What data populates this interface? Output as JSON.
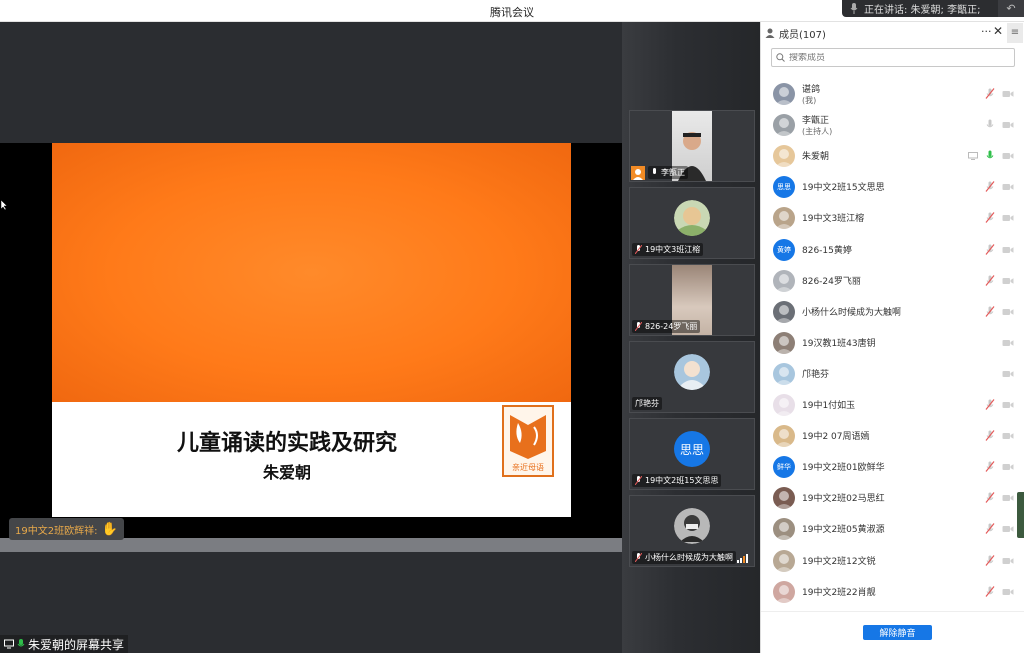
{
  "window": {
    "title": "腾讯会议"
  },
  "speaking": {
    "text": "正在讲话: 朱爱朝; 李甑正;"
  },
  "share": {
    "slide_title": "儿童诵读的实践及研究",
    "slide_author": "朱爱朝",
    "logo_text": "亲近母语",
    "reaction_name": "19中文2班欧辉祥:",
    "share_label": "朱爱朝的屏幕共享"
  },
  "video_tiles": [
    {
      "name": "李甑正",
      "type": "camera",
      "host": true
    },
    {
      "name": "19中文3班江榕",
      "type": "avatar"
    },
    {
      "name": "826-24罗飞丽",
      "type": "room"
    },
    {
      "name": "邝艳芬",
      "type": "avatar"
    },
    {
      "name": "19中文2班15文思思",
      "type": "initials",
      "initials": "思思"
    },
    {
      "name": "小杨什么时候成为大触啊",
      "type": "avatar",
      "signal": true
    }
  ],
  "panel": {
    "title": "成员(107)",
    "more": "···",
    "search_placeholder": "搜索成员",
    "unmute_all": "解除静音"
  },
  "members": [
    {
      "name": "谌鸽",
      "sub": "(我)",
      "mic": "muted",
      "cam": "off",
      "avatar_color": "#8a94a6"
    },
    {
      "name": "李甑正",
      "sub": "(主持人)",
      "mic": "on-gray",
      "cam": "off",
      "avatar_color": "#9aa0a6"
    },
    {
      "name": "朱爱朝",
      "mic": "active",
      "cam": "off",
      "screen": true,
      "avatar_color": "#e6c79a"
    },
    {
      "name": "19中文2班15文思思",
      "mic": "muted",
      "cam": "off",
      "initials": "思思",
      "avatar_color": "#1677e6"
    },
    {
      "name": "19中文3班江榕",
      "mic": "muted",
      "cam": "off",
      "avatar_color": "#b9a48a"
    },
    {
      "name": "826-15黄婷",
      "mic": "muted",
      "cam": "off",
      "initials": "黄婷",
      "avatar_color": "#1677e6"
    },
    {
      "name": "826-24罗飞丽",
      "mic": "muted",
      "cam": "off",
      "avatar_color": "#b0b4ba"
    },
    {
      "name": "小杨什么时候成为大触啊",
      "mic": "muted",
      "cam": "off",
      "avatar_color": "#6b6f76"
    },
    {
      "name": "19汉教1班43唐钥",
      "mic": "none",
      "cam": "off",
      "avatar_color": "#8d7f76"
    },
    {
      "name": "邝艳芬",
      "mic": "none",
      "cam": "off",
      "avatar_color": "#a8c6de"
    },
    {
      "name": "19中1付如玉",
      "mic": "muted",
      "cam": "off",
      "avatar_color": "#e8dfe8"
    },
    {
      "name": "19中2 07周语嫣",
      "mic": "muted",
      "cam": "off",
      "avatar_color": "#d9b98a"
    },
    {
      "name": "19中文2班01欧鲜华",
      "mic": "muted",
      "cam": "off",
      "initials": "鲜华",
      "avatar_color": "#1677e6"
    },
    {
      "name": "19中文2班02马思红",
      "mic": "muted",
      "cam": "off",
      "avatar_color": "#7a5c52"
    },
    {
      "name": "19中文2班05黄淑源",
      "mic": "muted",
      "cam": "off",
      "avatar_color": "#9c8f80"
    },
    {
      "name": "19中文2班12文锐",
      "mic": "muted",
      "cam": "off",
      "avatar_color": "#b8a894"
    },
    {
      "name": "19中文2班22肖靓",
      "mic": "muted",
      "cam": "off",
      "avatar_color": "#cfa7a0"
    }
  ],
  "colors": {
    "accent": "#1677e6",
    "muted_red": "#e45a5a",
    "active_green": "#2fbf4a",
    "slide_orange": "#ff7a19"
  }
}
